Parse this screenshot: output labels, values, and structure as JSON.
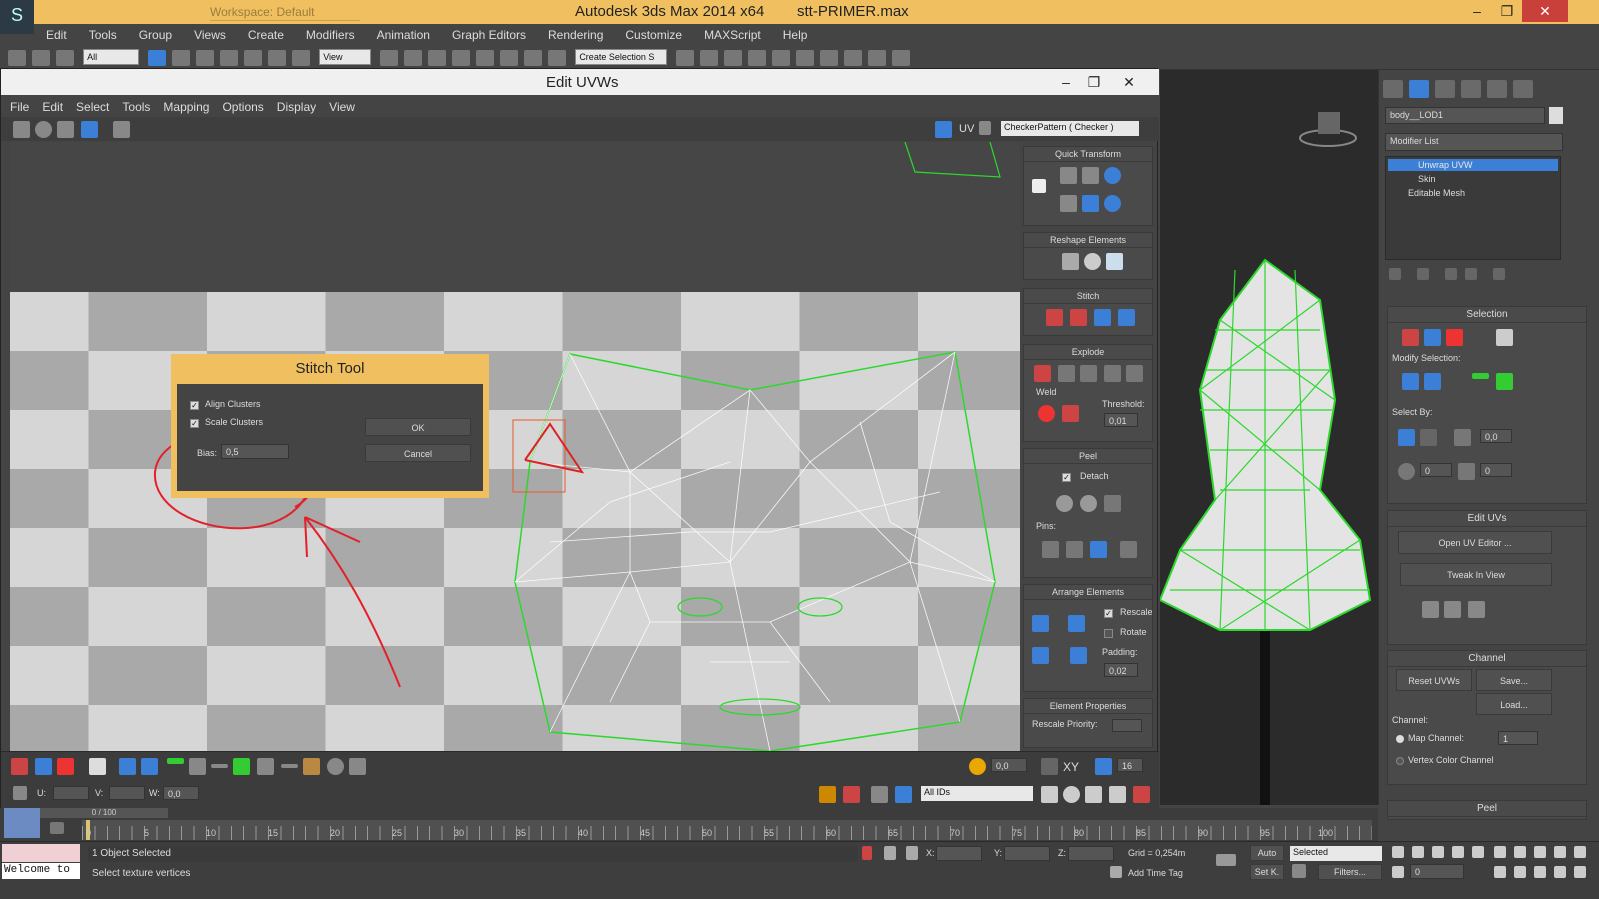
{
  "titlebar": {
    "workspace": "Workspace: Default",
    "app": "Autodesk 3ds Max  2014 x64",
    "file": "stt-PRIMER.max",
    "min": "–",
    "max": "❐",
    "close": "✕"
  },
  "menu": [
    "Edit",
    "Tools",
    "Group",
    "Views",
    "Create",
    "Modifiers",
    "Animation",
    "Graph Editors",
    "Rendering",
    "Customize",
    "MAXScript",
    "Help"
  ],
  "toolbar": {
    "filter": "All",
    "refcoord": "View",
    "selset": "Create Selection S"
  },
  "uv": {
    "title": "Edit UVWs",
    "menu": [
      "File",
      "Edit",
      "Select",
      "Tools",
      "Mapping",
      "Options",
      "Display",
      "View"
    ],
    "uv_label": "UV",
    "texture": "CheckerPattern  ( Checker )",
    "side": {
      "quick_transform": "Quick Transform",
      "reshape": "Reshape Elements",
      "stitch": "Stitch",
      "explode": "Explode",
      "weld": "Weld",
      "threshold": "Threshold:",
      "threshold_val": "0,01",
      "peel": "Peel",
      "detach": "Detach",
      "pins": "Pins:",
      "arrange": "Arrange Elements",
      "rescale": "Rescale",
      "rotate": "Rotate",
      "padding": "Padding:",
      "padding_val": "0,02",
      "elem_props": "Element Properties",
      "rescale_priority": "Rescale Priority:"
    },
    "bottom": {
      "u": "U:",
      "v": "V:",
      "w": "W:",
      "w_val": "0,0",
      "val": "0,0",
      "xy": "XY",
      "grid": "16",
      "ids": "All IDs"
    }
  },
  "stitch_dialog": {
    "title": "Stitch Tool",
    "align": "Align Clusters",
    "scale": "Scale Clusters",
    "bias_label": "Bias:",
    "bias_val": "0,5",
    "ok": "OK",
    "cancel": "Cancel"
  },
  "cmd": {
    "object_name": "body__LOD1",
    "modifier_list": "Modifier List",
    "stack": [
      "Unwrap UVW",
      "Skin",
      "Editable Mesh"
    ],
    "selection": "Selection",
    "modify_selection": "Modify Selection:",
    "select_by": "Select By:",
    "sb_val1": "0,0",
    "sb_val2": "0",
    "sb_val3": "0",
    "edit_uvs": "Edit UVs",
    "open_uv": "Open UV Editor ...",
    "tweak": "Tweak In View",
    "channel": "Channel",
    "reset": "Reset UVWs",
    "save": "Save...",
    "load": "Load...",
    "channel_lbl": "Channel:",
    "map_channel": "Map Channel:",
    "map_val": "1",
    "vertex_color": "Vertex Color Channel",
    "peel": "Peel"
  },
  "timeline": {
    "frame": "0 / 100",
    "ticks": [
      "0",
      "5",
      "10",
      "15",
      "20",
      "25",
      "30",
      "35",
      "40",
      "45",
      "50",
      "55",
      "60",
      "65",
      "70",
      "75",
      "80",
      "85",
      "90",
      "95",
      "100"
    ]
  },
  "status": {
    "welcome": "Welcome  to",
    "selected": "1 Object Selected",
    "prompt": "Select texture vertices",
    "x": "X:",
    "y": "Y:",
    "z": "Z:",
    "grid": "Grid = 0,254m",
    "add_tag": "Add Time Tag",
    "auto": "Auto",
    "setk": "Set K.",
    "sel_mode": "Selected",
    "filters": "Filters...",
    "frame_val": "0"
  }
}
